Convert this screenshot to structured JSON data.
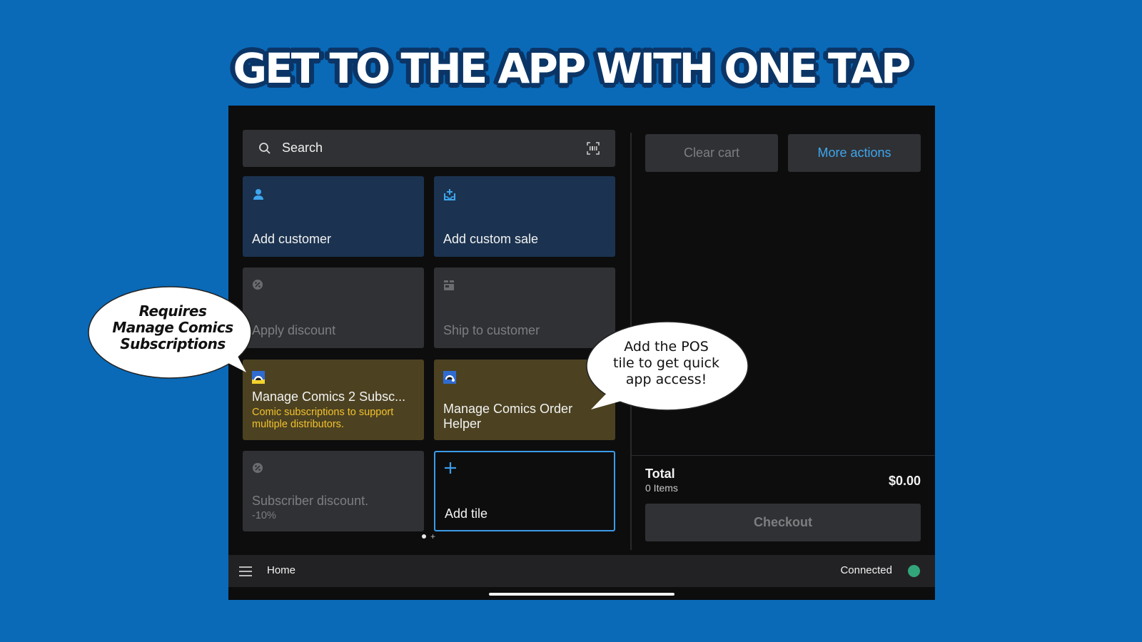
{
  "headline": "GET TO THE APP WITH ONE TAP",
  "search": {
    "placeholder": "Search",
    "icon": "search-icon",
    "scan_icon": "barcode-scan-icon"
  },
  "tiles": [
    {
      "label": "Add customer",
      "icon": "person-icon",
      "style": "blue"
    },
    {
      "label": "Add custom sale",
      "icon": "tray-add-icon",
      "style": "blue"
    },
    {
      "label": "Apply discount",
      "icon": "discount-badge-icon",
      "style": "grey",
      "disabled": true
    },
    {
      "label": "Ship to customer",
      "icon": "shipping-box-icon",
      "style": "grey",
      "disabled": true
    },
    {
      "label": "Manage Comics 2 Subsc...",
      "sub": "Comic subscriptions to support multiple distributors.",
      "icon": "manage-comics-app-icon",
      "style": "olive"
    },
    {
      "label": "Manage Comics Order Helper",
      "icon": "manage-comics-order-icon",
      "style": "olive"
    },
    {
      "label": "Subscriber discount.",
      "sub": "-10%",
      "icon": "discount-badge-icon",
      "style": "grey",
      "disabled": true
    },
    {
      "label": "Add tile",
      "icon": "plus-icon",
      "style": "dark"
    }
  ],
  "pager": {
    "current_page": 1,
    "pages": 1,
    "add_page": "+"
  },
  "cart": {
    "clear_label": "Clear cart",
    "more_label": "More actions",
    "total_label": "Total",
    "items_label": "0 Items",
    "total_value": "$0.00",
    "checkout_label": "Checkout"
  },
  "bottombar": {
    "menu_icon": "hamburger-menu-icon",
    "home_label": "Home",
    "status_label": "Connected",
    "status_color": "#33a57a"
  },
  "callouts": {
    "left": [
      "Requires",
      "Manage Comics",
      "Subscriptions"
    ],
    "right": [
      "Add the POS",
      "tile to get quick",
      "app access!"
    ]
  },
  "colors": {
    "accent": "#3c9be8",
    "background": "#0a6ab8",
    "subtitle_yellow": "#f2c12e"
  }
}
